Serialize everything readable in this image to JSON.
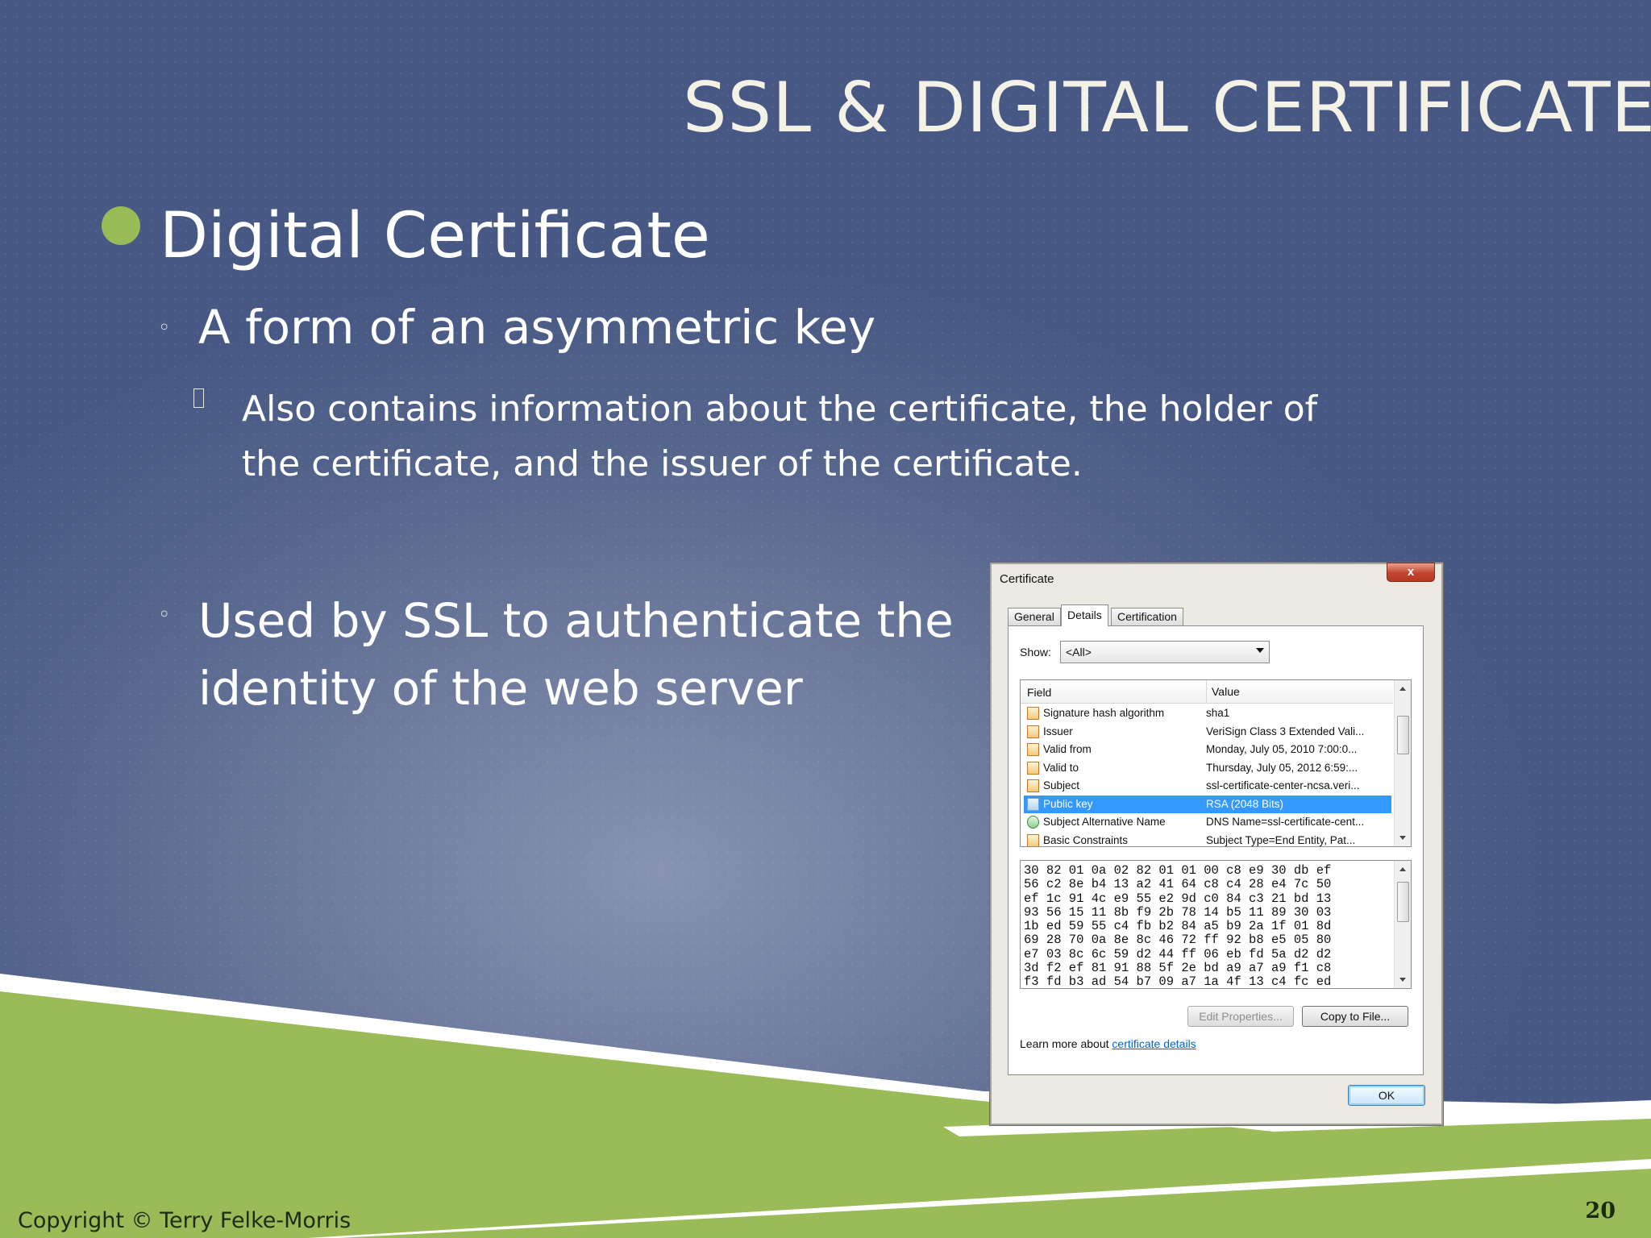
{
  "slide": {
    "title": "SSL & DIGITAL CERTIFICATE",
    "bullets": {
      "level1": "Digital Certificate",
      "level2_a": "A form of an asymmetric key",
      "level3_a": "Also contains information about the certificate, the holder of the certificate, and the issuer of the certificate.",
      "level2_b": "Used by SSL to authenticate the identity of the  web server"
    },
    "bullet_markers": {
      "level1": "●",
      "level2": "◦",
      "level3": "□"
    },
    "footer": {
      "copyright": "Copyright © Terry Felke-Morris",
      "page_number": "20"
    },
    "colors": {
      "background": "#55658c",
      "accent_green": "#9bbb59",
      "title": "#f4f2e6",
      "text": "#ffffff"
    }
  },
  "dialog": {
    "title": "Certificate",
    "close_label": "x",
    "tabs": [
      {
        "label": "General"
      },
      {
        "label": "Details",
        "active": true
      },
      {
        "label": "Certification Path"
      }
    ],
    "show_label": "Show:",
    "show_value": "<All>",
    "columns": [
      "Field",
      "Value"
    ],
    "rows": [
      {
        "field": "Signature hash algorithm",
        "value": "sha1",
        "icon": "certificate-field-icon"
      },
      {
        "field": "Issuer",
        "value": "VeriSign Class 3 Extended Vali...",
        "icon": "certificate-field-icon"
      },
      {
        "field": "Valid from",
        "value": "Monday, July 05, 2010 7:00:0...",
        "icon": "certificate-field-icon"
      },
      {
        "field": "Valid to",
        "value": "Thursday, July 05, 2012 6:59:...",
        "icon": "certificate-field-icon"
      },
      {
        "field": "Subject",
        "value": "ssl-certificate-center-ncsa.veri...",
        "icon": "certificate-field-icon"
      },
      {
        "field": "Public key",
        "value": "RSA (2048 Bits)",
        "icon": "certificate-field-icon",
        "selected": true
      },
      {
        "field": "Subject Alternative Name",
        "value": "DNS Name=ssl-certificate-cent...",
        "icon": "extension-icon"
      },
      {
        "field": "Basic Constraints",
        "value": "Subject Type=End Entity, Pat...",
        "icon": "certificate-field-icon"
      }
    ],
    "hex_lines": [
      "30 82 01 0a 02 82 01 01 00 c8 e9 30 db ef",
      "56 c2 8e b4 13 a2 41 64 c8 c4 28 e4 7c 50",
      "ef 1c 91 4c e9 55 e2 9d c0 84 c3 21 bd 13",
      "93 56 15 11 8b f9 2b 78 14 b5 11 89 30 03",
      "1b ed 59 55 c4 fb b2 84 a5 b9 2a 1f 01 8d",
      "69 28 70 0a 8e 8c 46 72 ff 92 b8 e5 05 80",
      "e7 03 8c 6c 59 d2 44 ff 06 eb fd 5a d2 d2",
      "3d f2 ef 81 91 88 5f 2e bd a9 a7 a9 f1 c8",
      "f3 fd b3 ad 54 b7 09 a7 1a 4f 13 c4 fc ed"
    ],
    "buttons": {
      "edit_properties": "Edit Properties...",
      "copy_to_file": "Copy to File...",
      "ok": "OK"
    },
    "learn_more_prefix": "Learn more about ",
    "learn_more_link": "certificate details"
  }
}
